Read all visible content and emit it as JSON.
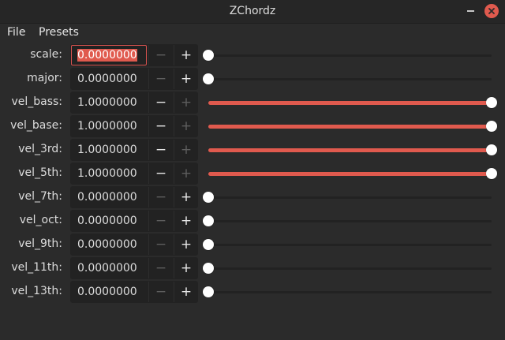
{
  "window": {
    "title": "ZChordz"
  },
  "menu": {
    "file": "File",
    "presets": "Presets"
  },
  "colors": {
    "accent": "#e05a4e",
    "background": "#2b2b2b",
    "field": "#222222"
  },
  "icons": {
    "minimize": "minimize-icon",
    "close": "close-icon",
    "decrement": "minus-icon",
    "increment": "plus-icon"
  },
  "params": [
    {
      "label": "scale:",
      "value": "0.0000000",
      "level": 0,
      "focused": true,
      "dec_enabled": false,
      "inc_enabled": true,
      "dec": "−",
      "inc": "+"
    },
    {
      "label": "major:",
      "value": "0.0000000",
      "level": 0,
      "focused": false,
      "dec_enabled": false,
      "inc_enabled": true,
      "dec": "−",
      "inc": "+"
    },
    {
      "label": "vel_bass:",
      "value": "1.0000000",
      "level": 1,
      "focused": false,
      "dec_enabled": true,
      "inc_enabled": false,
      "dec": "−",
      "inc": "+"
    },
    {
      "label": "vel_base:",
      "value": "1.0000000",
      "level": 1,
      "focused": false,
      "dec_enabled": true,
      "inc_enabled": false,
      "dec": "−",
      "inc": "+"
    },
    {
      "label": "vel_3rd:",
      "value": "1.0000000",
      "level": 1,
      "focused": false,
      "dec_enabled": true,
      "inc_enabled": false,
      "dec": "−",
      "inc": "+"
    },
    {
      "label": "vel_5th:",
      "value": "1.0000000",
      "level": 1,
      "focused": false,
      "dec_enabled": true,
      "inc_enabled": false,
      "dec": "−",
      "inc": "+"
    },
    {
      "label": "vel_7th:",
      "value": "0.0000000",
      "level": 0,
      "focused": false,
      "dec_enabled": false,
      "inc_enabled": true,
      "dec": "−",
      "inc": "+"
    },
    {
      "label": "vel_oct:",
      "value": "0.0000000",
      "level": 0,
      "focused": false,
      "dec_enabled": false,
      "inc_enabled": true,
      "dec": "−",
      "inc": "+"
    },
    {
      "label": "vel_9th:",
      "value": "0.0000000",
      "level": 0,
      "focused": false,
      "dec_enabled": false,
      "inc_enabled": true,
      "dec": "−",
      "inc": "+"
    },
    {
      "label": "vel_11th:",
      "value": "0.0000000",
      "level": 0,
      "focused": false,
      "dec_enabled": false,
      "inc_enabled": true,
      "dec": "−",
      "inc": "+"
    },
    {
      "label": "vel_13th:",
      "value": "0.0000000",
      "level": 0,
      "focused": false,
      "dec_enabled": false,
      "inc_enabled": true,
      "dec": "−",
      "inc": "+"
    }
  ]
}
